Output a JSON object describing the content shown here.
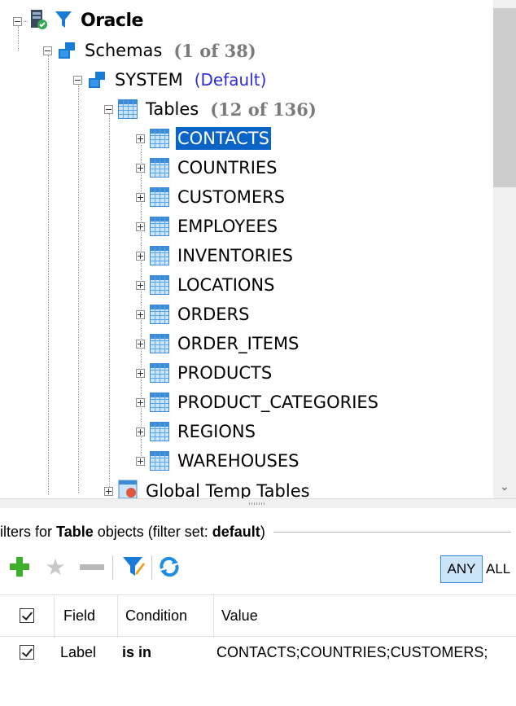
{
  "tree": {
    "root": {
      "label": "Oracle"
    },
    "schemas": {
      "label": "Schemas",
      "count": "(1 of 38)"
    },
    "schema": {
      "label": "SYSTEM",
      "tag": "(Default)"
    },
    "tables": {
      "label": "Tables",
      "count": "(12 of 136)"
    },
    "items": [
      "CONTACTS",
      "COUNTRIES",
      "CUSTOMERS",
      "EMPLOYEES",
      "INVENTORIES",
      "LOCATIONS",
      "ORDERS",
      "ORDER_ITEMS",
      "PRODUCTS",
      "PRODUCT_CATEGORIES",
      "REGIONS",
      "WAREHOUSES"
    ],
    "selected_item": "CONTACTS",
    "global_temp": {
      "label": "Global Temp Tables"
    }
  },
  "filter": {
    "header_prefix": "ilters for",
    "header_object": "Table",
    "header_middle": "objects (filter set:",
    "header_set": "default",
    "header_suffix": ")"
  },
  "toolbar": {
    "any_label": "ANY",
    "all_label": "ALL"
  },
  "grid": {
    "columns": [
      "Field",
      "Condition",
      "Value"
    ],
    "rows": [
      {
        "field": "Label",
        "condition": "is in",
        "value": "CONTACTS;COUNTRIES;CUSTOMERS;"
      }
    ]
  },
  "colors": {
    "selection": "#0a64c8",
    "default_tag": "#2b2bdc",
    "count": "#7b7b7b",
    "add_green": "#3fae2a",
    "accent_blue": "#1f8ee0"
  },
  "icons": [
    "database-icon",
    "filter-icon",
    "schema-icon",
    "table-icon",
    "plus-icon",
    "star-icon",
    "minus-icon",
    "refresh-icon",
    "checkbox-icon"
  ]
}
